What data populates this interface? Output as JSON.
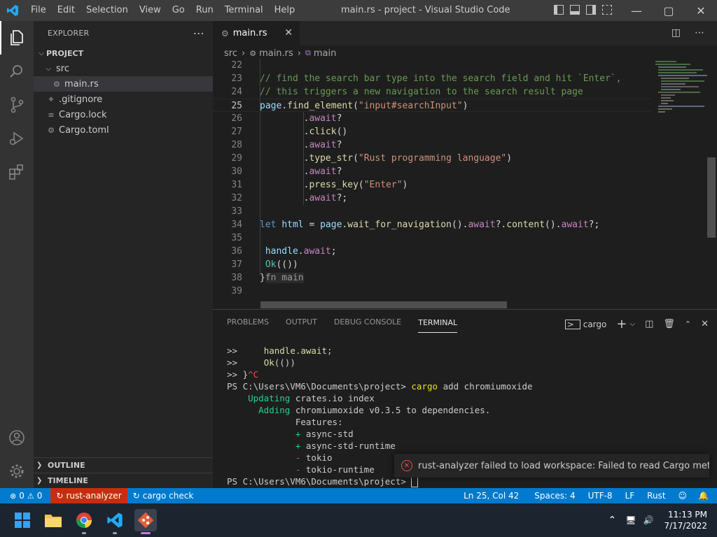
{
  "window": {
    "title": "main.rs - project - Visual Studio Code",
    "menu": [
      "File",
      "Edit",
      "Selection",
      "View",
      "Go",
      "Run",
      "Terminal",
      "Help"
    ]
  },
  "sidebar": {
    "title": "EXPLORER",
    "project": "PROJECT",
    "tree": [
      {
        "name": "src",
        "type": "folder"
      },
      {
        "name": "main.rs",
        "type": "rust-file"
      },
      {
        "name": ".gitignore",
        "type": "file"
      },
      {
        "name": "Cargo.lock",
        "type": "file"
      },
      {
        "name": "Cargo.toml",
        "type": "settings-file"
      }
    ],
    "outline": "OUTLINE",
    "timeline": "TIMELINE"
  },
  "editor": {
    "tab": "main.rs",
    "breadcrumbs": [
      "src",
      "main.rs",
      "main"
    ],
    "lines": [
      {
        "n": "22",
        "html": ""
      },
      {
        "n": "23",
        "html": "<span class=\"c\">// find the search bar type into the search field and hit `Enter`,</span>"
      },
      {
        "n": "24",
        "html": "<span class=\"c\">// this triggers a new navigation to the search result page</span>"
      },
      {
        "n": "25",
        "html": "<span class=\"v\">page</span>.<span class=\"f\">find_element</span>(<span class=\"s\">\"input#searchInput\"</span>)"
      },
      {
        "n": "26",
        "html": "        .<span class=\"aw\">await</span>?"
      },
      {
        "n": "27",
        "html": "        .<span class=\"f\">click</span>()"
      },
      {
        "n": "28",
        "html": "        .<span class=\"aw\">await</span>?"
      },
      {
        "n": "29",
        "html": "        .<span class=\"f\">type_str</span>(<span class=\"s\">\"Rust programming language\"</span>)"
      },
      {
        "n": "30",
        "html": "        .<span class=\"aw\">await</span>?"
      },
      {
        "n": "31",
        "html": "        .<span class=\"f\">press_key</span>(<span class=\"s\">\"Enter\"</span>)"
      },
      {
        "n": "32",
        "html": "        .<span class=\"aw\">await</span>?;"
      },
      {
        "n": "33",
        "html": ""
      },
      {
        "n": "34",
        "html": "<span class=\"k\">let</span> <span class=\"v\">html</span> = <span class=\"v\">page</span>.<span class=\"f\">wait_for_navigation</span>().<span class=\"aw\">await</span>?.<span class=\"f\">content</span>().<span class=\"aw\">await</span>?;"
      },
      {
        "n": "35",
        "html": ""
      },
      {
        "n": "36",
        "html": " <span class=\"v\">handle</span>.<span class=\"aw\">await</span>;"
      },
      {
        "n": "37",
        "html": " <span class=\"ty\">Ok</span>(())"
      },
      {
        "n": "38",
        "html": "}<span style=\"background:#2b2b2b;color:#9a9a9a\">fn main</span>"
      },
      {
        "n": "39",
        "html": ""
      }
    ],
    "current_line": "25"
  },
  "panel": {
    "tabs": [
      "PROBLEMS",
      "OUTPUT",
      "DEBUG CONSOLE",
      "TERMINAL"
    ],
    "active_tab": "TERMINAL",
    "terminal_name": "cargo",
    "terminal_lines": [
      "<span>>>     </span><span class=\"ty2\">handle</span>.<span class=\"ty2\">await</span>;",
      "<span>>>     </span><span class=\"ty2\">Ok</span>(())",
      "<span>>> </span>}<span class=\"red\">^C</span>",
      "PS C:\\Users\\VM6\\Documents\\project> <span class=\"yl\">cargo</span> add chromiumoxide",
      "    <span class=\"grn\">Updating</span> crates.io index",
      "      <span class=\"grn\">Adding</span> chromiumoxide v0.3.5 to dependencies.",
      "             Features:",
      "             <span class=\"grn\">+</span> async-std",
      "             <span class=\"grn\">+</span> async-std-runtime",
      "             <span class=\"red\">-</span> tokio",
      "             <span class=\"red\">-</span> tokio-runtime",
      "PS C:\\Users\\VM6\\Documents\\project> <span style=\"border:1px solid #ccc\"> </span>"
    ],
    "notification": "rust-analyzer failed to load workspace: Failed to read Cargo metadata ..."
  },
  "status": {
    "errors": "0",
    "warnings": "0",
    "rust_analyzer": "rust-analyzer",
    "cargo_check": "cargo check",
    "position": "Ln 25, Col 42",
    "spaces": "Spaces: 4",
    "encoding": "UTF-8",
    "eol": "LF",
    "language": "Rust"
  },
  "taskbar": {
    "time": "11:13 PM",
    "date": "7/17/2022"
  }
}
